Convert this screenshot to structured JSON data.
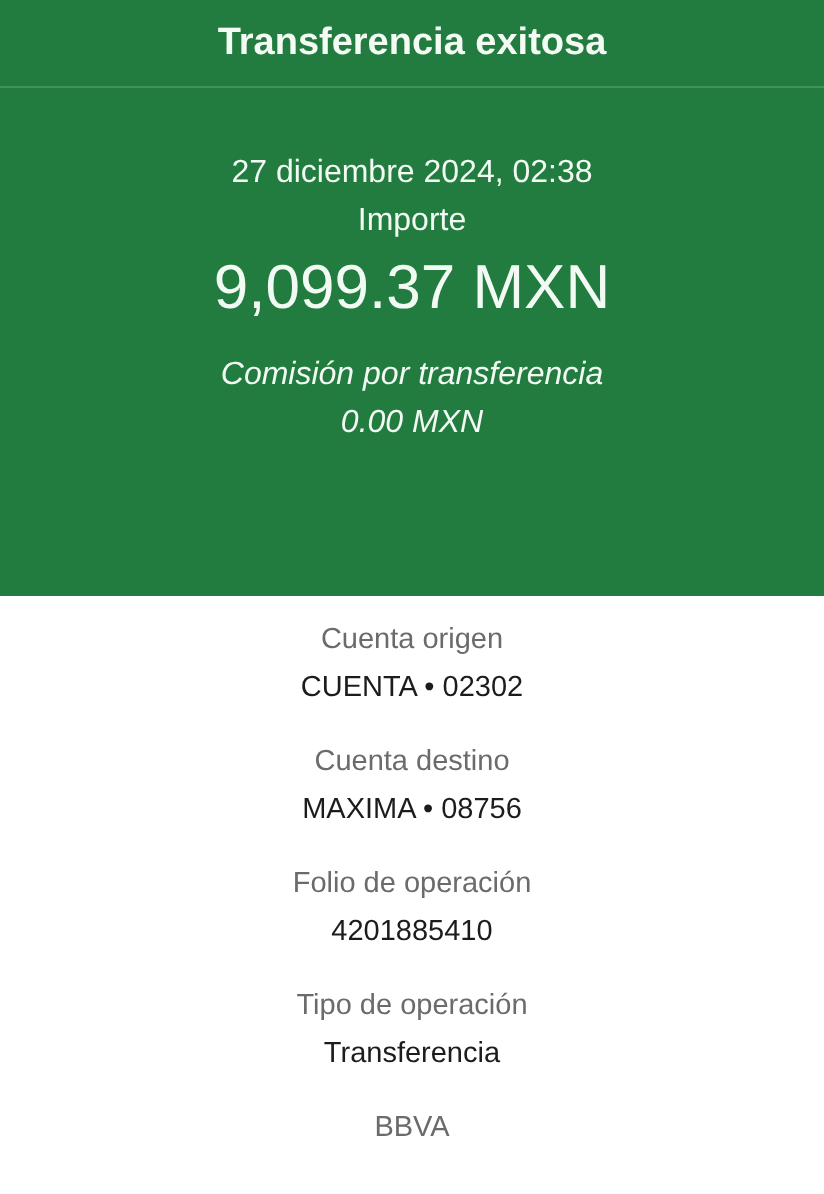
{
  "header": {
    "title": "Transferencia exitosa"
  },
  "summary": {
    "datetime": "27 diciembre 2024, 02:38",
    "amount_label": "Importe",
    "amount": "9,099.37 MXN",
    "fee_label": "Comisión por transferencia",
    "fee": "0.00 MXN"
  },
  "details": [
    {
      "label": "Cuenta origen",
      "value": "CUENTA • 02302"
    },
    {
      "label": "Cuenta destino",
      "value": "MAXIMA • 08756"
    },
    {
      "label": "Folio de operación",
      "value": "4201885410"
    },
    {
      "label": "Tipo de operación",
      "value": "Transferencia"
    }
  ],
  "footer": {
    "text": "BBVA"
  }
}
